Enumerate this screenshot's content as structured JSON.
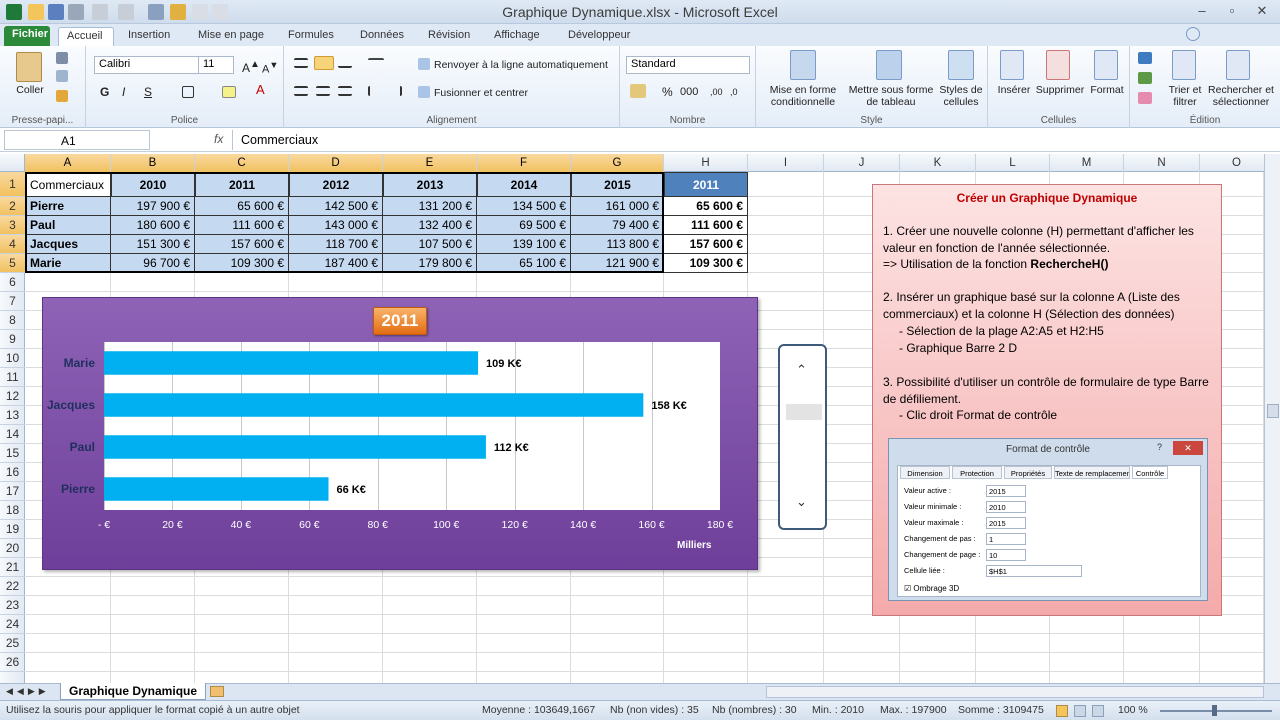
{
  "window": {
    "title": "Graphique Dynamique.xlsx - Microsoft Excel"
  },
  "ribbon_tabs": [
    "Fichier",
    "Accueil",
    "Insertion",
    "Mise en page",
    "Formules",
    "Données",
    "Révision",
    "Affichage",
    "Développeur"
  ],
  "clipboard": {
    "paste": "Coller",
    "group": "Presse-papi..."
  },
  "font": {
    "name": "Calibri",
    "size": "11",
    "group": "Police",
    "bold": "G",
    "italic": "I",
    "underline": "S"
  },
  "alignment": {
    "wrap": "Renvoyer à la ligne automatiquement",
    "merge": "Fusionner et centrer",
    "group": "Alignement"
  },
  "number": {
    "format": "Standard",
    "group": "Nombre"
  },
  "style": {
    "cond": "Mise en forme\nconditionnelle",
    "table": "Mettre sous forme\nde tableau",
    "cell_styles": "Styles de\ncellules",
    "group": "Style"
  },
  "cells": {
    "insert": "Insérer",
    "delete": "Supprimer",
    "format": "Format",
    "group": "Cellules"
  },
  "editing": {
    "sort": "Trier et\nfiltrer",
    "find": "Rechercher et\nsélectionner",
    "group": "Édition"
  },
  "formula_bar": {
    "name_box": "A1",
    "fx": "fx",
    "value": "Commerciaux"
  },
  "columns": [
    "A",
    "B",
    "C",
    "D",
    "E",
    "F",
    "G",
    "H",
    "I",
    "J",
    "K",
    "L",
    "M",
    "N",
    "O"
  ],
  "rows": [
    "1",
    "2",
    "3",
    "4",
    "5",
    "6",
    "7",
    "8",
    "9",
    "10",
    "11",
    "12",
    "13",
    "14",
    "15",
    "16",
    "17",
    "18",
    "19",
    "20",
    "21",
    "22",
    "23",
    "24",
    "25",
    "26"
  ],
  "table": {
    "header": [
      "Commerciaux",
      "2010",
      "2011",
      "2012",
      "2013",
      "2014",
      "2015",
      "2011"
    ],
    "rows": [
      [
        "Pierre",
        "197 900 €",
        "65 600 €",
        "142 500 €",
        "131 200 €",
        "134 500 €",
        "161 000 €",
        "65 600 €"
      ],
      [
        "Paul",
        "180 600 €",
        "111 600 €",
        "143 000 €",
        "132 400 €",
        "69 500 €",
        "79 400 €",
        "111 600 €"
      ],
      [
        "Jacques",
        "151 300 €",
        "157 600 €",
        "118 700 €",
        "107 500 €",
        "139 100 €",
        "113 800 €",
        "157 600 €"
      ],
      [
        "Marie",
        "96 700 €",
        "109 300 €",
        "187 400 €",
        "179 800 €",
        "65 100 €",
        "121 900 €",
        "109 300 €"
      ]
    ]
  },
  "chart_data": {
    "type": "bar",
    "title": "2011",
    "categories": [
      "Marie",
      "Jacques",
      "Paul",
      "Pierre"
    ],
    "values": [
      109.3,
      157.6,
      111.6,
      65.6
    ],
    "data_labels": [
      "109 K€",
      "158 K€",
      "112 K€",
      "66 K€"
    ],
    "xlim": [
      0,
      180
    ],
    "x_ticks": [
      "-  €",
      "20 €",
      "40 €",
      "60 €",
      "80 €",
      "100 €",
      "120 €",
      "140 €",
      "160 €",
      "180 €"
    ],
    "xlabel": "Milliers",
    "bar_color": "#00b0f0",
    "grid": true
  },
  "note": {
    "title": "Créer un Graphique Dynamique",
    "lines": [
      "1. Créer une nouvelle colonne (H) permettant d'afficher les valeur en fonction de l'année sélectionnée.",
      "=> Utilisation de la fonction ",
      "RechercheH()",
      "2. Insérer  un graphique basé sur la colonne A (Liste des commerciaux) et la  colonne H (Sélection des données)",
      "- Sélection de la plage A2:A5 et H2:H5",
      "- Graphique Barre 2 D",
      "3. Possibilité d'utiliser un contrôle de formulaire de type Barre de défiliement.",
      "- Clic droit Format de contrôle"
    ]
  },
  "dialog": {
    "title": "Format de contrôle",
    "help": "?",
    "tabs": [
      "Dimension",
      "Protection",
      "Propriétés",
      "Texte de remplacement",
      "Contrôle"
    ],
    "fields": [
      {
        "label": "Valeur active :",
        "value": "2015"
      },
      {
        "label": "Valeur minimale :",
        "value": "2010"
      },
      {
        "label": "Valeur maximale :",
        "value": "2015"
      },
      {
        "label": "Changement de pas :",
        "value": "1"
      },
      {
        "label": "Changement de page :",
        "value": "10"
      },
      {
        "label": "Cellule liée :",
        "value": "$H$1"
      }
    ],
    "shading": "Ombrage 3D"
  },
  "sheet_tab": "Graphique Dynamique",
  "status": {
    "message": "Utilisez la souris pour appliquer le format copié à un autre objet",
    "average": "Moyenne : 103649,1667",
    "count": "Nb (non vides) : 35",
    "numcount": "Nb (nombres) : 30",
    "min": "Min. : 2010",
    "max": "Max. : 197900",
    "sum": "Somme : 3109475",
    "zoom": "100 %"
  },
  "colors": {
    "accent": "#2a8a3a",
    "header_fill": "#c5d9f1",
    "h1_fill": "#4f81bd",
    "chart_bg": "#7f4faa",
    "title_box": "#f79646"
  }
}
